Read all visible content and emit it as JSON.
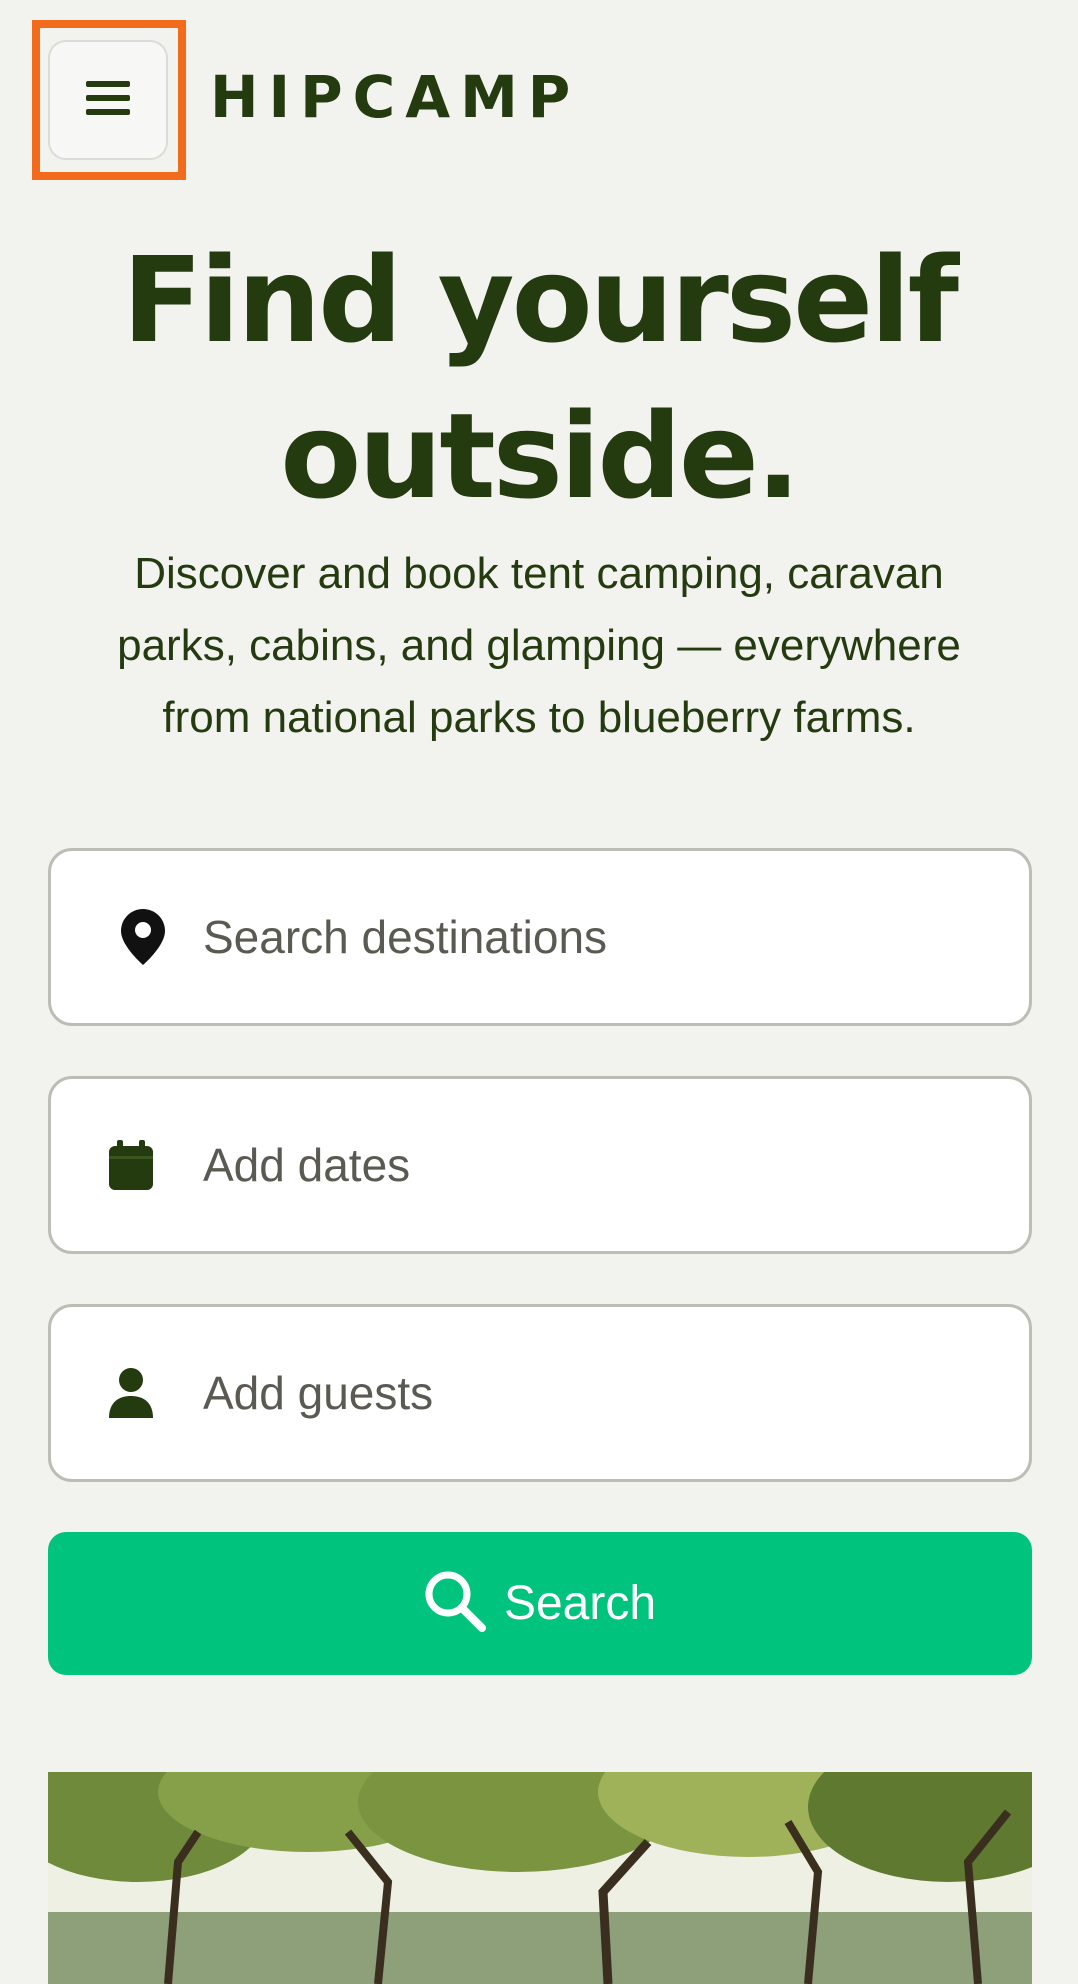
{
  "header": {
    "menu_icon": "hamburger-icon",
    "logo_text": "HIPCAMP",
    "highlight_color": "#f26a1b"
  },
  "hero": {
    "title_line1": "Find yourself",
    "title_line2": "outside.",
    "subtitle": "Discover and book tent camping, caravan parks, cabins, and glamping — everywhere from national parks to blueberry farms."
  },
  "search": {
    "destination": {
      "icon": "map-pin-icon",
      "placeholder": "Search destinations"
    },
    "dates": {
      "icon": "calendar-icon",
      "placeholder": "Add dates"
    },
    "guests": {
      "icon": "person-icon",
      "placeholder": "Add guests"
    },
    "button": {
      "icon": "magnifier-icon",
      "label": "Search",
      "color": "#00c47d"
    }
  },
  "colors": {
    "background": "#f2f2ef",
    "brand_dark_green": "#243a0f"
  }
}
